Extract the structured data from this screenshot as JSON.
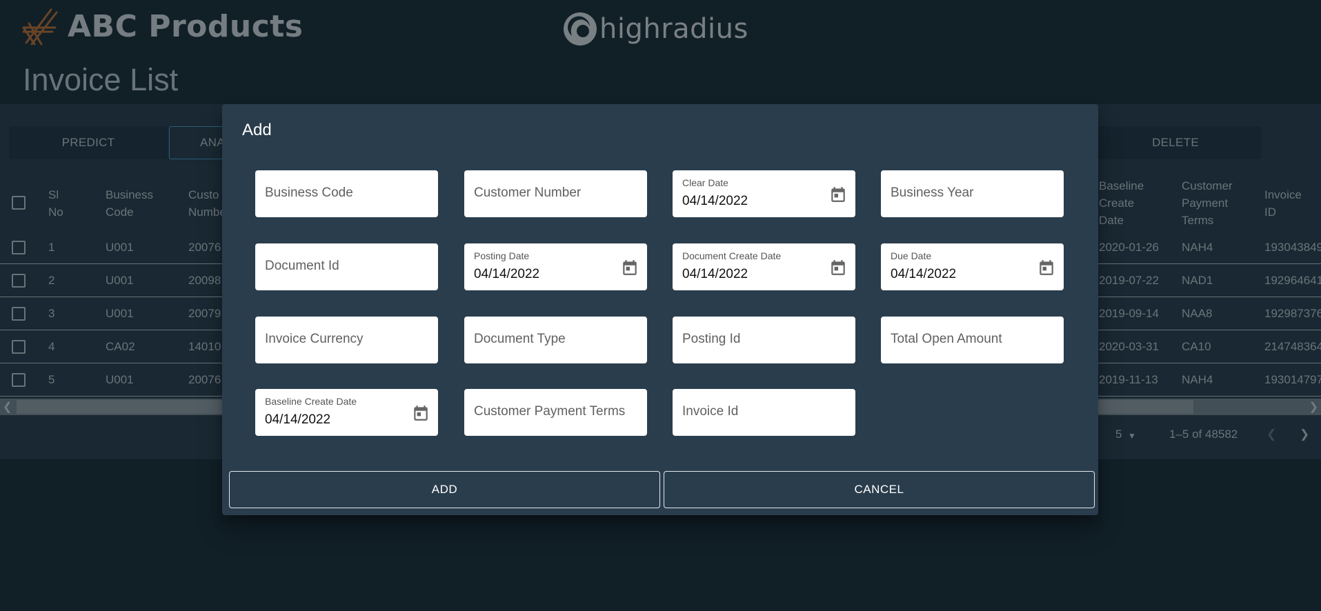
{
  "header": {
    "brand_name": "ABC Products",
    "partner_logo_text": "highradius",
    "page_title": "Invoice List"
  },
  "toolbar": {
    "predict_label": "PREDICT",
    "analytics_label_partial": "ANA",
    "delete_label": "DELETE"
  },
  "table": {
    "left_headers": [
      "Sl No",
      "Business Code",
      "Custo Numbe"
    ],
    "right_headers": [
      "Baseline Create Date",
      "Customer Payment Terms",
      "Invoice ID"
    ],
    "rows": [
      {
        "sl": "1",
        "business_code": "U001",
        "customer_partial": "20076",
        "baseline": "2020-01-26",
        "terms": "NAH4",
        "invoice_partial": "193043849"
      },
      {
        "sl": "2",
        "business_code": "U001",
        "customer_partial": "20098",
        "baseline": "2019-07-22",
        "terms": "NAD1",
        "invoice_partial": "192964641"
      },
      {
        "sl": "3",
        "business_code": "U001",
        "customer_partial": "20079",
        "baseline": "2019-09-14",
        "terms": "NAA8",
        "invoice_partial": "192987376"
      },
      {
        "sl": "4",
        "business_code": "CA02",
        "customer_partial": "14010",
        "baseline": "2020-03-31",
        "terms": "CA10",
        "invoice_partial": "214748364"
      },
      {
        "sl": "5",
        "business_code": "U001",
        "customer_partial": "20076",
        "baseline": "2019-11-13",
        "terms": "NAH4",
        "invoice_partial": "193014797"
      }
    ]
  },
  "pagination": {
    "rows_per_page": "5",
    "range": "1–5 of 48582"
  },
  "dialog": {
    "title": "Add",
    "fields": {
      "business_code": {
        "placeholder": "Business Code"
      },
      "customer_number": {
        "placeholder": "Customer Number"
      },
      "clear_date": {
        "label": "Clear Date",
        "value": "04/14/2022"
      },
      "business_year": {
        "placeholder": "Business Year"
      },
      "document_id": {
        "placeholder": "Document Id"
      },
      "posting_date": {
        "label": "Posting Date",
        "value": "04/14/2022"
      },
      "document_create_date": {
        "label": "Document Create Date",
        "value": "04/14/2022"
      },
      "due_date": {
        "label": "Due Date",
        "value": "04/14/2022"
      },
      "invoice_currency": {
        "placeholder": "Invoice Currency"
      },
      "document_type": {
        "placeholder": "Document Type"
      },
      "posting_id": {
        "placeholder": "Posting Id"
      },
      "total_open_amount": {
        "placeholder": "Total Open Amount"
      },
      "baseline_create_date": {
        "label": "Baseline Create Date",
        "value": "04/14/2022"
      },
      "customer_payment_terms": {
        "placeholder": "Customer Payment Terms"
      },
      "invoice_id": {
        "placeholder": "Invoice Id"
      }
    },
    "add_label": "ADD",
    "cancel_label": "CANCEL"
  },
  "icons": {
    "calendar": "calendar-icon",
    "chevron_left": "chevron-left-icon",
    "chevron_right": "chevron-right-icon",
    "dropdown": "arrow-drop-down-icon"
  },
  "colors": {
    "page_bg": "#192b35",
    "panel_bg": "#283d4b",
    "dialog_bg": "#2a3d4c",
    "brand_orange": "#c87532",
    "outline_blue": "#4aa8d8"
  }
}
